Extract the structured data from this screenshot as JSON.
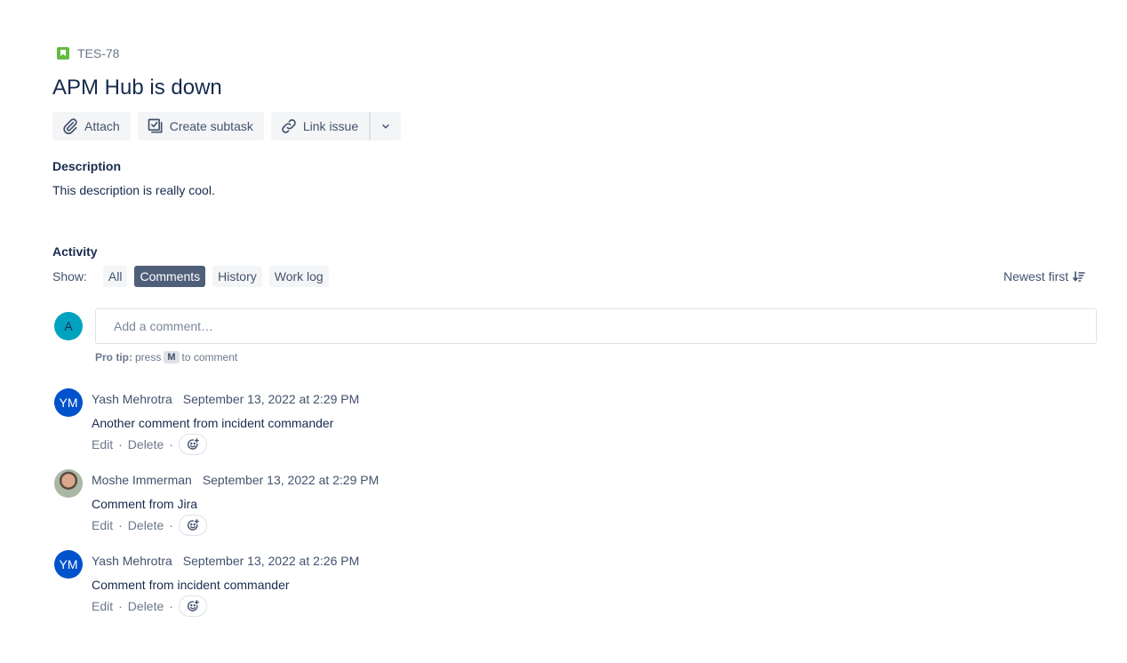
{
  "issue": {
    "key": "TES-78",
    "type_icon": "story-icon",
    "title": "APM Hub is down"
  },
  "toolbar": {
    "attach_label": "Attach",
    "create_subtask_label": "Create subtask",
    "link_issue_label": "Link issue"
  },
  "description": {
    "heading": "Description",
    "text": "This description is really cool."
  },
  "activity": {
    "heading": "Activity",
    "show_label": "Show:",
    "filters": [
      {
        "label": "All",
        "active": false
      },
      {
        "label": "Comments",
        "active": true
      },
      {
        "label": "History",
        "active": false
      },
      {
        "label": "Work log",
        "active": false
      }
    ],
    "sort_label": "Newest first"
  },
  "composer": {
    "avatar_initials": "A",
    "placeholder": "Add a comment…",
    "protip_bold": "Pro tip:",
    "protip_pre": "press",
    "protip_key": "M",
    "protip_post": "to comment"
  },
  "comments": [
    {
      "author": "Yash Mehrotra",
      "initials": "YM",
      "timestamp": "September 13, 2022 at 2:29 PM",
      "body": "Another comment from incident commander"
    },
    {
      "author": "Moshe Immerman",
      "initials": "",
      "timestamp": "September 13, 2022 at 2:29 PM",
      "body": "Comment from Jira"
    },
    {
      "author": "Yash Mehrotra",
      "initials": "YM",
      "timestamp": "September 13, 2022 at 2:26 PM",
      "body": "Comment from incident commander"
    }
  ],
  "comment_actions": {
    "edit": "Edit",
    "delete": "Delete",
    "separator": "·"
  }
}
